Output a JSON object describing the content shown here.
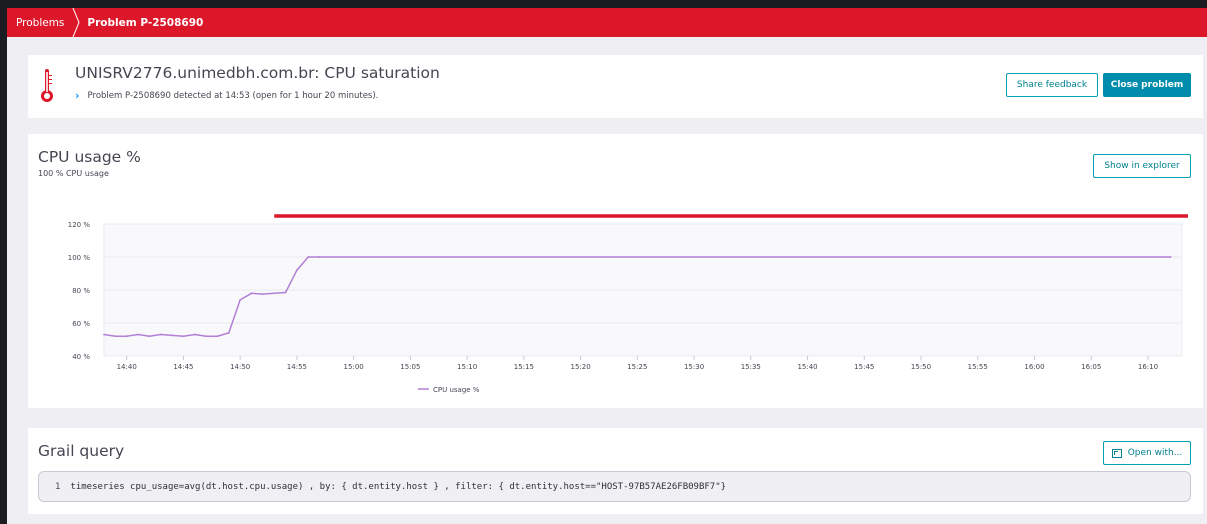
{
  "breadcrumb": {
    "items": [
      "Problems",
      "Problem P-2508690"
    ]
  },
  "problem": {
    "title": "UNISRV2776.unimedbh.com.br: CPU saturation",
    "subtitle": "Problem P-2508690 detected at 14:53 (open for 1 hour 20 minutes).",
    "icon": "thermometer-icon",
    "share_feedback_label": "Share feedback",
    "close_problem_label": "Close problem"
  },
  "chart_panel": {
    "title": "CPU usage %",
    "subtitle": "100 % CPU usage",
    "explorer_label": "Show in explorer"
  },
  "chart_data": {
    "type": "line",
    "x": [
      "14:38",
      "14:39",
      "14:40",
      "14:41",
      "14:42",
      "14:43",
      "14:44",
      "14:45",
      "14:46",
      "14:47",
      "14:48",
      "14:49",
      "14:50",
      "14:51",
      "14:52",
      "14:53",
      "14:54",
      "14:55",
      "14:56",
      "14:57",
      "16:12"
    ],
    "series": [
      {
        "name": "CPU usage %",
        "color": "#b27fd6",
        "values": [
          53,
          52,
          52,
          53,
          52,
          53,
          52.5,
          52,
          53,
          52,
          52,
          54,
          74,
          78,
          77.5,
          78,
          78.5,
          92,
          100,
          100,
          100
        ]
      }
    ],
    "ylim": [
      40,
      120
    ],
    "yticks": [
      "40 %",
      "60 %",
      "80 %",
      "100 %",
      "120 %"
    ],
    "ytick_values": [
      40,
      60,
      80,
      100,
      120
    ],
    "xticks": [
      "14:40",
      "14:45",
      "14:50",
      "14:55",
      "15:00",
      "15:05",
      "15:10",
      "15:15",
      "15:20",
      "15:25",
      "15:30",
      "15:35",
      "15:40",
      "15:45",
      "15:50",
      "15:55",
      "16:00",
      "16:05",
      "16:10"
    ],
    "x_start": "14:38",
    "x_end": "16:13",
    "event_marker": {
      "start": "14:53",
      "end": "16:13",
      "color": "#dc172a"
    },
    "legend_label": "CPU usage %",
    "legend_position": "bottom-center",
    "grid": true
  },
  "grail": {
    "title": "Grail query",
    "open_with_label": "Open with...",
    "line_number": "1",
    "query": "timeseries cpu_usage=avg(dt.host.cpu.usage) , by: { dt.entity.host } , filter: { dt.entity.host==\"HOST-97B57AE26FB09BF7\"}"
  }
}
